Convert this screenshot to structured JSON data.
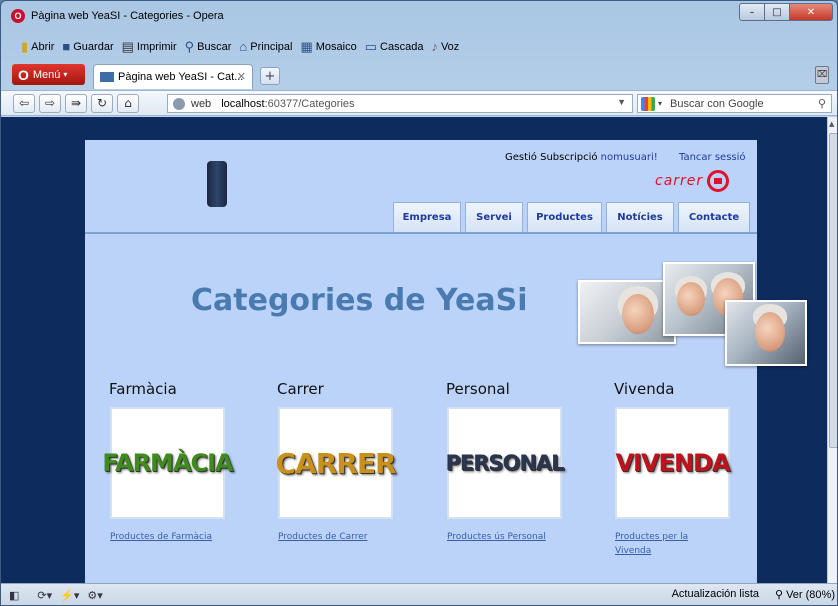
{
  "window": {
    "title": "Pàgina web YeaSI - Categories - Opera",
    "controls": {
      "minimize": "–",
      "maximize": "□",
      "close": "✕"
    }
  },
  "menubar": {
    "items": [
      {
        "label": "Abrir",
        "icon": "folder-icon"
      },
      {
        "label": "Guardar",
        "icon": "save-icon"
      },
      {
        "label": "Imprimir",
        "icon": "print-icon"
      },
      {
        "label": "Buscar",
        "icon": "search-icon"
      },
      {
        "label": "Principal",
        "icon": "home-icon"
      },
      {
        "label": "Mosaico",
        "icon": "tile-icon"
      },
      {
        "label": "Cascada",
        "icon": "cascade-icon"
      },
      {
        "label": "Voz",
        "icon": "voice-icon"
      }
    ]
  },
  "tabs": {
    "menu_label": "Menú",
    "active_tab": "Pàgina web YeaSI - Cat...",
    "close": "✕",
    "new_tab": "+"
  },
  "address": {
    "scheme_label": "web",
    "host": "localhost",
    "path": ":60377/Categories",
    "search_placeholder": "Buscar con Google"
  },
  "page": {
    "user_prefix": "Gestió Subscripció",
    "username": "nomusuari!",
    "logout": "Tancar sessió",
    "logo_text": "carrer",
    "nav": [
      "Empresa",
      "Servei",
      "Productes",
      "Notícies",
      "Contacte"
    ],
    "heading": "Categories de YeaSi",
    "categories": [
      {
        "title": "Farmàcia",
        "image_word": "FARMÀCIA",
        "color": "#3f8b1f",
        "link": "Productes de Farmàcia"
      },
      {
        "title": "Carrer",
        "image_word": "CARRER",
        "color": "#c9911b",
        "link": "Productes de Carrer"
      },
      {
        "title": "Personal",
        "image_word": "PERSONAL",
        "color": "#2a3550",
        "link": "Productes ús Personal"
      },
      {
        "title": "Vivenda",
        "image_word": "VIVENDA",
        "color": "#c1121c",
        "link": "Productes per la Vivenda"
      }
    ]
  },
  "statusbar": {
    "status": "Actualización lista",
    "zoom": "Ver (80%)"
  }
}
